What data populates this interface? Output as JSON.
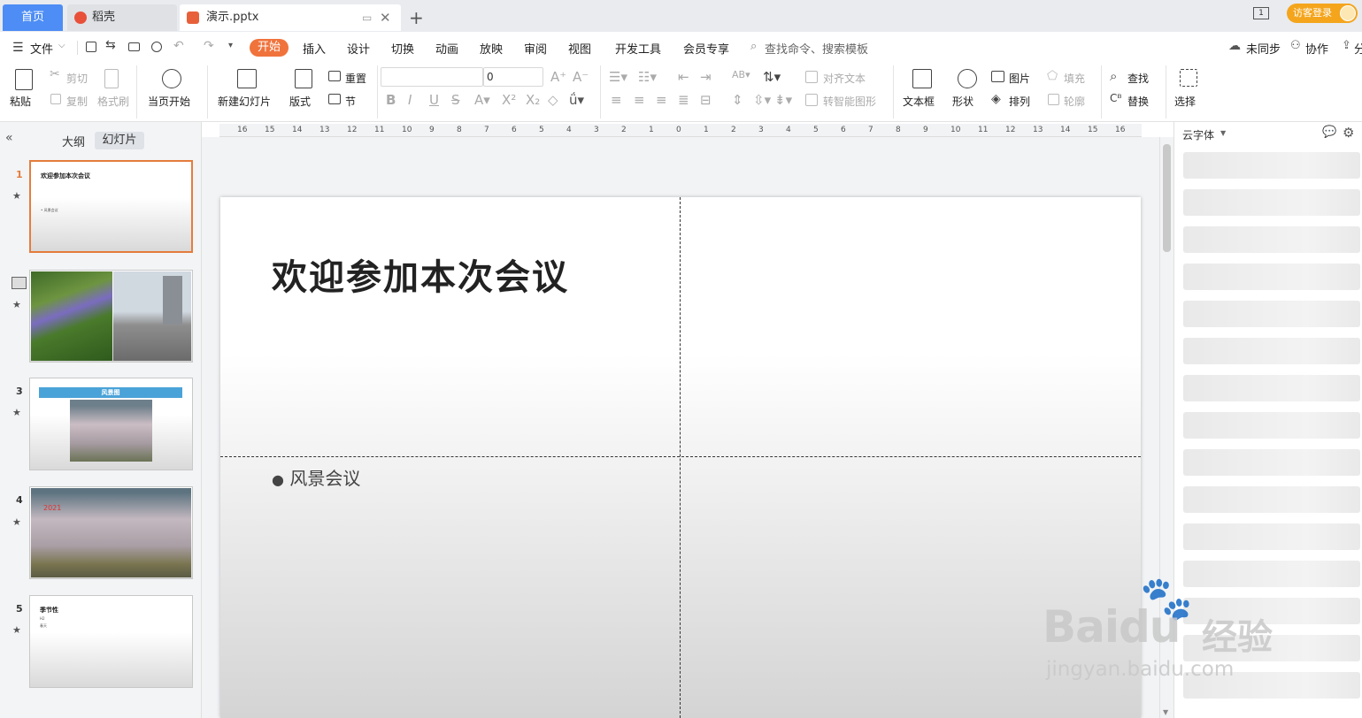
{
  "titlebar": {
    "home_tab": "首页",
    "tabs": [
      {
        "label": "稻壳"
      },
      {
        "label": "演示.pptx"
      }
    ],
    "login_label": "访客登录",
    "window_badge": "1"
  },
  "menubar": {
    "file_label": "文件",
    "items": [
      "开始",
      "插入",
      "设计",
      "切换",
      "动画",
      "放映",
      "审阅",
      "视图",
      "开发工具",
      "会员专享"
    ],
    "search_label": "查找命令、搜索模板",
    "sync_label": "未同步",
    "collab_label": "协作",
    "share_label": "分"
  },
  "ribbon": {
    "paste": "粘贴",
    "cut": "剪切",
    "copy": "复制",
    "format_painter": "格式刷",
    "play_from_current": "当页开始",
    "new_slide": "新建幻灯片",
    "layout": "版式",
    "reset": "重置",
    "section": "节",
    "font_size": "0",
    "align_text": "对齐文本",
    "smartart": "转智能图形",
    "textbox": "文本框",
    "shape": "形状",
    "picture": "图片",
    "arrange": "排列",
    "fill": "填充",
    "outline": "轮廓",
    "find": "查找",
    "replace": "替换",
    "select": "选择"
  },
  "leftpanel": {
    "tab_outline": "大纲",
    "tab_slides": "幻灯片",
    "slides": [
      {
        "num": "1",
        "title": "欢迎参加本次会议",
        "sub": "• 风景会议"
      },
      {
        "num": "2"
      },
      {
        "num": "3",
        "banner": "风景图"
      },
      {
        "num": "4",
        "label": "2021"
      },
      {
        "num": "5",
        "title": "季节性",
        "sub1": "H2",
        "sub2": "春天"
      }
    ]
  },
  "ruler": [
    "16",
    "15",
    "14",
    "13",
    "12",
    "11",
    "10",
    "9",
    "8",
    "7",
    "6",
    "5",
    "4",
    "3",
    "2",
    "1",
    "0",
    "1",
    "2",
    "3",
    "4",
    "5",
    "6",
    "7",
    "8",
    "9",
    "10",
    "11",
    "12",
    "13",
    "14",
    "15",
    "16"
  ],
  "slide": {
    "title": "欢迎参加本次会议",
    "bullet": "风景会议"
  },
  "rightpanel": {
    "cloud_font": "云字体"
  },
  "watermark": {
    "brand": "Baidu",
    "cn": "经验",
    "url": "jingyan.baidu.com"
  }
}
